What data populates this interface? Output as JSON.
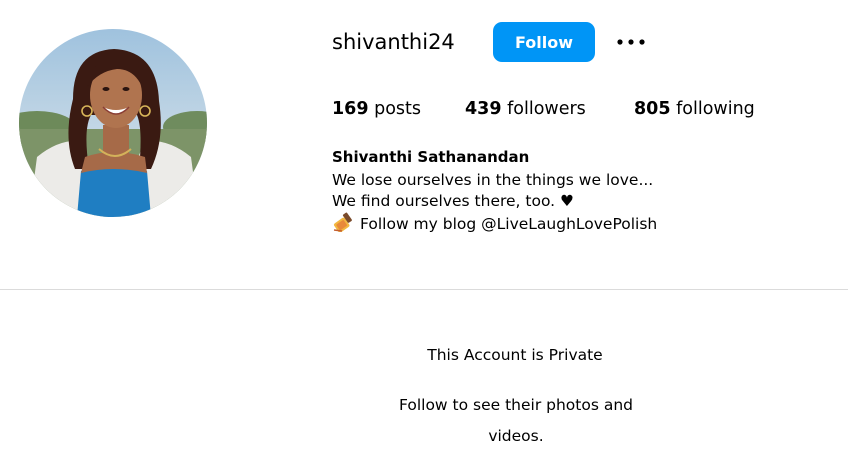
{
  "profile": {
    "username": "shivanthi24",
    "full_name": "Shivanthi Sathanandan",
    "avatar_icon": "profile-photo",
    "follow_label": "Follow",
    "more_icon": "more-options-icon"
  },
  "stats": {
    "posts_count": "169",
    "posts_label": "posts",
    "followers_count": "439",
    "followers_label": "followers",
    "following_count": "805",
    "following_label": "following"
  },
  "bio": {
    "line1": "We lose ourselves in the things we love...",
    "line2": "We find ourselves there, too. ♥",
    "line3": "Follow my blog @LiveLaughLovePolish",
    "line3_icon": "nail-polish-emoji"
  },
  "private": {
    "title": "This Account is Private",
    "subtitle": "Follow to see their photos and videos."
  },
  "colors": {
    "follow_button_bg": "#0095f6",
    "divider": "#dbdbdb"
  }
}
